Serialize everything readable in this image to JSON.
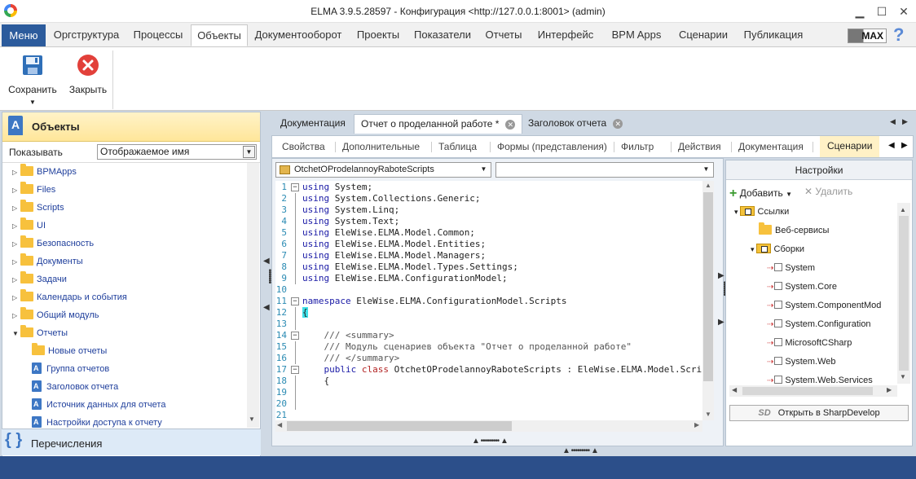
{
  "window": {
    "title": "ELMA 3.9.5.28597 - Конфигурация <http://127.0.0.1:8001> (admin)"
  },
  "menu": {
    "menu_button": "Меню",
    "tabs": [
      "Оргструктура",
      "Процессы",
      "Объекты",
      "Документооборот",
      "Проекты",
      "Показатели",
      "Отчеты",
      "Интерфейс",
      "BPM Apps",
      "Сценарии",
      "Публикация"
    ],
    "active_tab": "Объекты",
    "badge": "MAX",
    "help": "?"
  },
  "ribbon": {
    "save": "Сохранить",
    "close": "Закрыть"
  },
  "left_panel": {
    "title": "Объекты",
    "show_label": "Показывать",
    "show_value": "Отображаемое имя",
    "tree": [
      {
        "label": "BPMApps",
        "type": "folder",
        "level": 0,
        "expander": "collapsed"
      },
      {
        "label": "Files",
        "type": "folder",
        "level": 0,
        "expander": "collapsed"
      },
      {
        "label": "Scripts",
        "type": "folder",
        "level": 0,
        "expander": "collapsed"
      },
      {
        "label": "UI",
        "type": "folder",
        "level": 0,
        "expander": "collapsed"
      },
      {
        "label": "Безопасность",
        "type": "folder",
        "level": 0,
        "expander": "collapsed"
      },
      {
        "label": "Документы",
        "type": "folder",
        "level": 0,
        "expander": "collapsed"
      },
      {
        "label": "Задачи",
        "type": "folder",
        "level": 0,
        "expander": "collapsed"
      },
      {
        "label": "Календарь и события",
        "type": "folder",
        "level": 0,
        "expander": "collapsed"
      },
      {
        "label": "Общий модуль",
        "type": "folder",
        "level": 0,
        "expander": "collapsed"
      },
      {
        "label": "Отчеты",
        "type": "folder",
        "level": 0,
        "expander": "expanded"
      },
      {
        "label": "Новые отчеты",
        "type": "folder",
        "level": 1,
        "expander": "none"
      },
      {
        "label": "Группа отчетов",
        "type": "object",
        "level": 1,
        "expander": "none"
      },
      {
        "label": "Заголовок отчета",
        "type": "object",
        "level": 1,
        "expander": "none"
      },
      {
        "label": "Источник данных для отчета",
        "type": "object",
        "level": 1,
        "expander": "none"
      },
      {
        "label": "Настройки доступа к отчету",
        "type": "object",
        "level": 1,
        "expander": "none"
      }
    ],
    "enumerations": "Перечисления"
  },
  "doc_tabs": [
    {
      "label": "Документация",
      "active": false,
      "closable": false
    },
    {
      "label": "Отчет о проделанной работе *",
      "active": true,
      "closable": true
    },
    {
      "label": "Заголовок отчета",
      "active": false,
      "closable": true
    }
  ],
  "sub_tabs": [
    "Свойства",
    "Дополнительные",
    "Таблица",
    "Формы (представления)",
    "Фильтр",
    "Действия",
    "Документация",
    "Сценарии"
  ],
  "active_sub_tab": "Сценарии",
  "editor": {
    "class_combo": "OtchetOProdelannoyRaboteScripts",
    "member_combo": "",
    "lines": [
      {
        "n": "1",
        "fold": "−",
        "tokens": [
          {
            "t": "using",
            "c": "kw"
          },
          {
            "t": " System;",
            "c": ""
          }
        ]
      },
      {
        "n": "2",
        "fold": "",
        "tokens": [
          {
            "t": "using",
            "c": "kw"
          },
          {
            "t": " System.Collections.Generic;",
            "c": ""
          }
        ]
      },
      {
        "n": "3",
        "fold": "",
        "tokens": [
          {
            "t": "using",
            "c": "kw"
          },
          {
            "t": " System.Linq;",
            "c": ""
          }
        ]
      },
      {
        "n": "4",
        "fold": "",
        "tokens": [
          {
            "t": "using",
            "c": "kw"
          },
          {
            "t": " System.Text;",
            "c": ""
          }
        ]
      },
      {
        "n": "5",
        "fold": "",
        "tokens": [
          {
            "t": "using",
            "c": "kw"
          },
          {
            "t": " EleWise.ELMA.Model.Common;",
            "c": ""
          }
        ]
      },
      {
        "n": "6",
        "fold": "",
        "tokens": [
          {
            "t": "using",
            "c": "kw"
          },
          {
            "t": " EleWise.ELMA.Model.Entities;",
            "c": ""
          }
        ]
      },
      {
        "n": "7",
        "fold": "",
        "tokens": [
          {
            "t": "using",
            "c": "kw"
          },
          {
            "t": " EleWise.ELMA.Model.Managers;",
            "c": ""
          }
        ]
      },
      {
        "n": "8",
        "fold": "",
        "tokens": [
          {
            "t": "using",
            "c": "kw"
          },
          {
            "t": " EleWise.ELMA.Model.Types.Settings;",
            "c": ""
          }
        ]
      },
      {
        "n": "9",
        "fold": "",
        "tokens": [
          {
            "t": "using",
            "c": "kw"
          },
          {
            "t": " EleWise.ELMA.ConfigurationModel;",
            "c": ""
          }
        ]
      },
      {
        "n": "10",
        "fold": "",
        "tokens": []
      },
      {
        "n": "11",
        "fold": "−",
        "tokens": [
          {
            "t": "namespace",
            "c": "kw"
          },
          {
            "t": " EleWise.ELMA.ConfigurationModel.Scripts",
            "c": ""
          }
        ]
      },
      {
        "n": "12",
        "fold": "",
        "tokens": [
          {
            "t": "{",
            "c": "brace"
          }
        ]
      },
      {
        "n": "13",
        "fold": "",
        "tokens": []
      },
      {
        "n": "14",
        "fold": "−",
        "tokens": [
          {
            "t": "    /// <summary>",
            "c": "cm"
          }
        ]
      },
      {
        "n": "15",
        "fold": "",
        "tokens": [
          {
            "t": "    /// Модуль сценариев объекта \"Отчет о проделанной работе\"",
            "c": "cm"
          }
        ]
      },
      {
        "n": "16",
        "fold": "",
        "tokens": [
          {
            "t": "    /// </summary>",
            "c": "cm"
          }
        ]
      },
      {
        "n": "17",
        "fold": "−",
        "tokens": [
          {
            "t": "    public",
            "c": "kw"
          },
          {
            "t": " class",
            "c": "kw2"
          },
          {
            "t": " OtchetOProdelannoyRaboteScripts : EleWise.ELMA.Model.Scripts.Entit",
            "c": ""
          }
        ]
      },
      {
        "n": "18",
        "fold": "",
        "tokens": [
          {
            "t": "    {",
            "c": ""
          }
        ]
      },
      {
        "n": "19",
        "fold": "",
        "tokens": []
      },
      {
        "n": "20",
        "fold": "",
        "tokens": []
      },
      {
        "n": "21",
        "fold": "",
        "tokens": []
      }
    ]
  },
  "settings": {
    "title": "Настройки",
    "add": "Добавить",
    "remove": "Удалить",
    "tree": [
      {
        "label": "Ссылки",
        "level": 0,
        "icon": "refs"
      },
      {
        "label": "Веб-сервисы",
        "level": 1,
        "icon": "folder"
      },
      {
        "label": "Сборки",
        "level": 1,
        "icon": "refs"
      },
      {
        "label": "System",
        "level": 2,
        "icon": "assembly"
      },
      {
        "label": "System.Core",
        "level": 2,
        "icon": "assembly"
      },
      {
        "label": "System.ComponentMod",
        "level": 2,
        "icon": "assembly"
      },
      {
        "label": "System.Configuration",
        "level": 2,
        "icon": "assembly"
      },
      {
        "label": "MicrosoftCSharp",
        "level": 2,
        "icon": "assembly"
      },
      {
        "label": "System.Web",
        "level": 2,
        "icon": "assembly"
      },
      {
        "label": "System.Web.Services",
        "level": 2,
        "icon": "assembly"
      }
    ],
    "open_sharp": "Открыть в SharpDevelop",
    "sharp_badge": "SD"
  },
  "colors": {
    "accent": "#2c5b9c",
    "status_bar": "#2c4f8a",
    "header_yellow": "#ffe69a",
    "active_subtab": "#fff1c6"
  }
}
